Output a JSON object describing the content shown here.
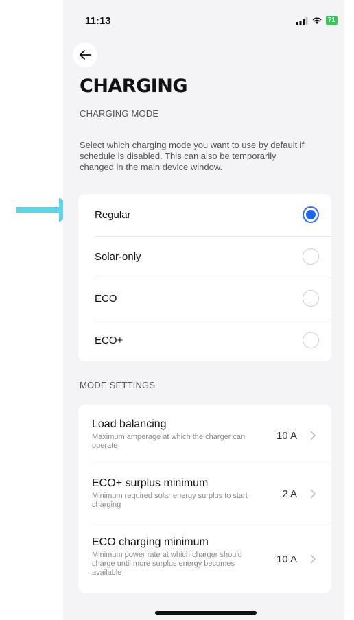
{
  "status_bar": {
    "time": "11:13",
    "battery": "71"
  },
  "header": {
    "title": "CHARGING"
  },
  "charging_mode": {
    "section_label": "CHARGING MODE",
    "description": "Select which charging mode you want to use by default if schedule is disabled. This can also be temporarily changed in the main device window.",
    "options": [
      {
        "label": "Regular",
        "selected": true
      },
      {
        "label": "Solar-only",
        "selected": false
      },
      {
        "label": "ECO",
        "selected": false
      },
      {
        "label": "ECO+",
        "selected": false
      }
    ]
  },
  "mode_settings": {
    "section_label": "MODE SETTINGS",
    "items": [
      {
        "title": "Load balancing",
        "description": "Maximum amperage at which the charger can operate",
        "value": "10 A"
      },
      {
        "title": "ECO+ surplus minimum",
        "description": "Minimum required solar energy surplus to start charging",
        "value": "2 A"
      },
      {
        "title": "ECO charging minimum",
        "description": "Minimum power rate at which charger should charge until more surplus energy becomes available",
        "value": "10 A"
      }
    ]
  },
  "colors": {
    "accent": "#1a66f0",
    "arrow": "#5ed4ea",
    "background": "#f4f4f6",
    "battery": "#34c759"
  },
  "icons": [
    "arrow-right-icon",
    "signal-icon",
    "wifi-icon",
    "battery-icon",
    "back-arrow-icon",
    "chevron-right-icon"
  ]
}
